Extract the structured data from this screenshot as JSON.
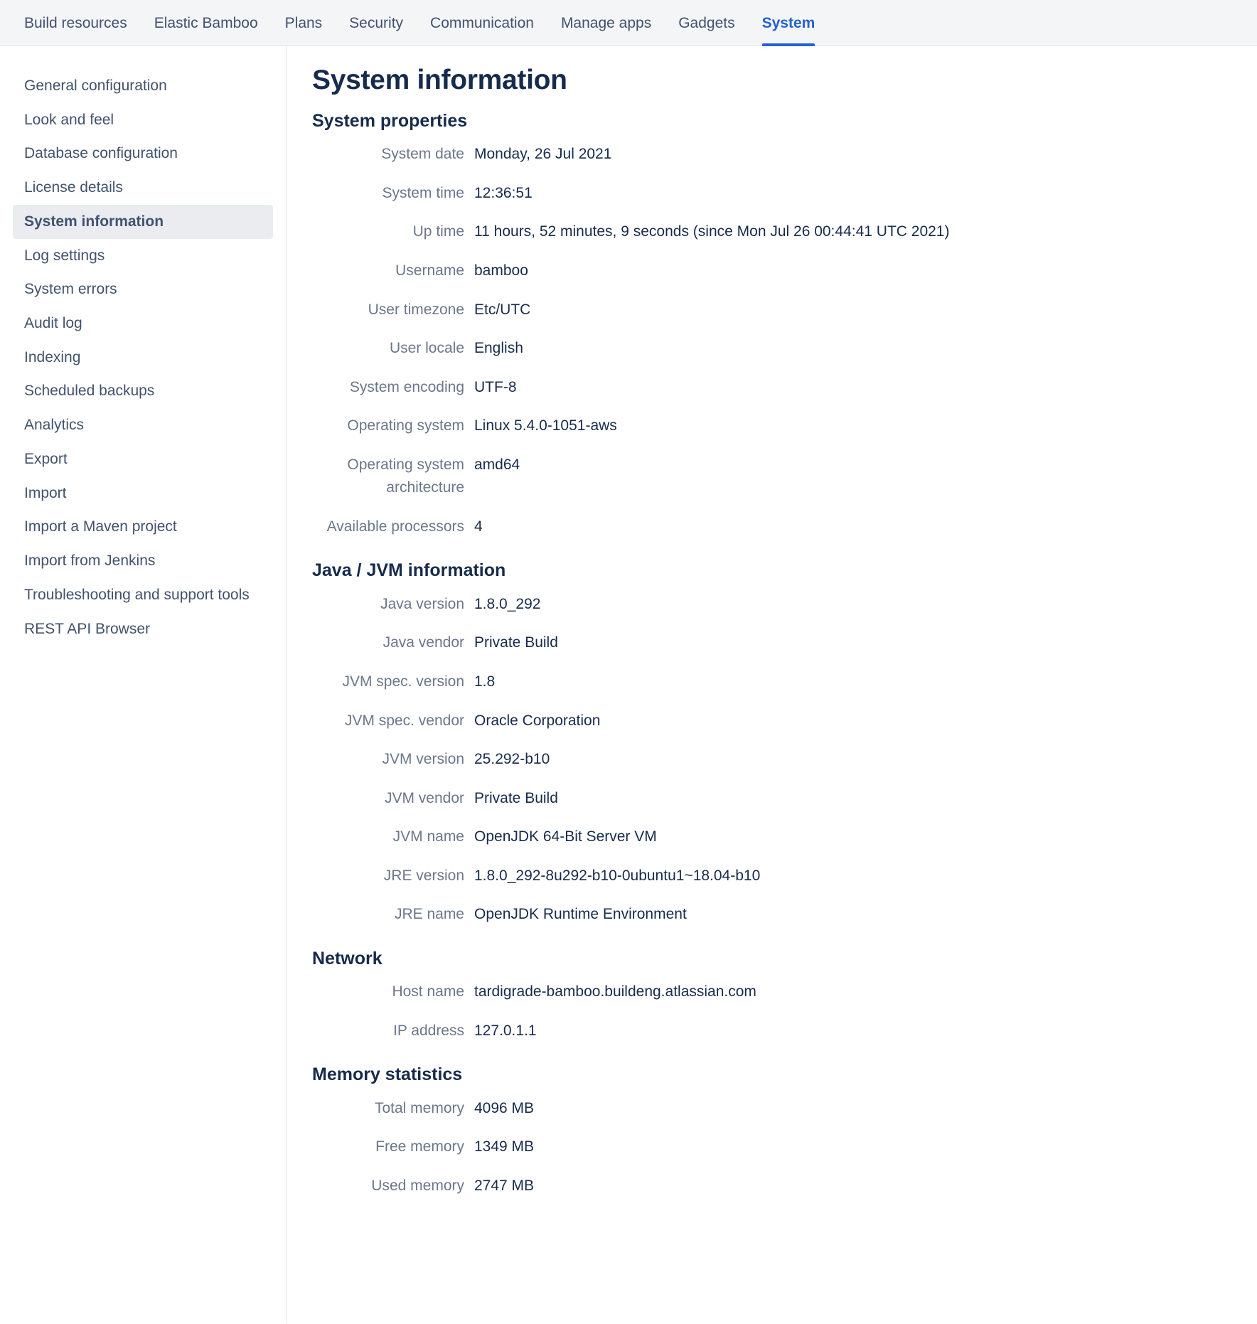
{
  "topnav": {
    "items": [
      {
        "label": "Build resources",
        "active": false
      },
      {
        "label": "Elastic Bamboo",
        "active": false
      },
      {
        "label": "Plans",
        "active": false
      },
      {
        "label": "Security",
        "active": false
      },
      {
        "label": "Communication",
        "active": false
      },
      {
        "label": "Manage apps",
        "active": false
      },
      {
        "label": "Gadgets",
        "active": false
      },
      {
        "label": "System",
        "active": true
      }
    ]
  },
  "sidebar": {
    "items": [
      {
        "label": "General configuration",
        "active": false
      },
      {
        "label": "Look and feel",
        "active": false
      },
      {
        "label": "Database configuration",
        "active": false
      },
      {
        "label": "License details",
        "active": false
      },
      {
        "label": "System information",
        "active": true
      },
      {
        "label": "Log settings",
        "active": false
      },
      {
        "label": "System errors",
        "active": false
      },
      {
        "label": "Audit log",
        "active": false
      },
      {
        "label": "Indexing",
        "active": false
      },
      {
        "label": "Scheduled backups",
        "active": false
      },
      {
        "label": "Analytics",
        "active": false
      },
      {
        "label": "Export",
        "active": false
      },
      {
        "label": "Import",
        "active": false
      },
      {
        "label": "Import a Maven project",
        "active": false
      },
      {
        "label": "Import from Jenkins",
        "active": false
      },
      {
        "label": "Troubleshooting and support tools",
        "active": false
      },
      {
        "label": "REST API Browser",
        "active": false
      }
    ]
  },
  "main": {
    "page_title": "System information",
    "sections": [
      {
        "title": "System properties",
        "rows": [
          {
            "label": "System date",
            "value": "Monday, 26 Jul 2021"
          },
          {
            "label": "System time",
            "value": "12:36:51"
          },
          {
            "label": "Up time",
            "value": "11 hours, 52 minutes, 9 seconds (since Mon Jul 26 00:44:41 UTC 2021)"
          },
          {
            "label": "Username",
            "value": "bamboo"
          },
          {
            "label": "User timezone",
            "value": "Etc/UTC"
          },
          {
            "label": "User locale",
            "value": "English"
          },
          {
            "label": "System encoding",
            "value": "UTF-8"
          },
          {
            "label": "Operating system",
            "value": "Linux 5.4.0-1051-aws"
          },
          {
            "label": "Operating system architecture",
            "value": "amd64"
          },
          {
            "label": "Available processors",
            "value": "4"
          }
        ]
      },
      {
        "title": "Java / JVM information",
        "rows": [
          {
            "label": "Java version",
            "value": "1.8.0_292"
          },
          {
            "label": "Java vendor",
            "value": "Private Build"
          },
          {
            "label": "JVM spec. version",
            "value": "1.8"
          },
          {
            "label": "JVM spec. vendor",
            "value": "Oracle Corporation"
          },
          {
            "label": "JVM version",
            "value": "25.292-b10"
          },
          {
            "label": "JVM vendor",
            "value": "Private Build"
          },
          {
            "label": "JVM name",
            "value": "OpenJDK 64-Bit Server VM"
          },
          {
            "label": "JRE version",
            "value": "1.8.0_292-8u292-b10-0ubuntu1~18.04-b10"
          },
          {
            "label": "JRE name",
            "value": "OpenJDK Runtime Environment"
          }
        ]
      },
      {
        "title": "Network",
        "rows": [
          {
            "label": "Host name",
            "value": "tardigrade-bamboo.buildeng.atlassian.com"
          },
          {
            "label": "IP address",
            "value": "127.0.1.1"
          }
        ]
      },
      {
        "title": "Memory statistics",
        "rows": [
          {
            "label": "Total memory",
            "value": "4096 MB"
          },
          {
            "label": "Free memory",
            "value": "1349 MB"
          },
          {
            "label": "Used memory",
            "value": "2747 MB"
          }
        ]
      }
    ]
  },
  "colors": {
    "accent": "#2461d4",
    "label": "#6b778c",
    "value": "#172b4d",
    "nav_bg": "#f4f5f7",
    "active_item_bg": "#ebecf0"
  }
}
